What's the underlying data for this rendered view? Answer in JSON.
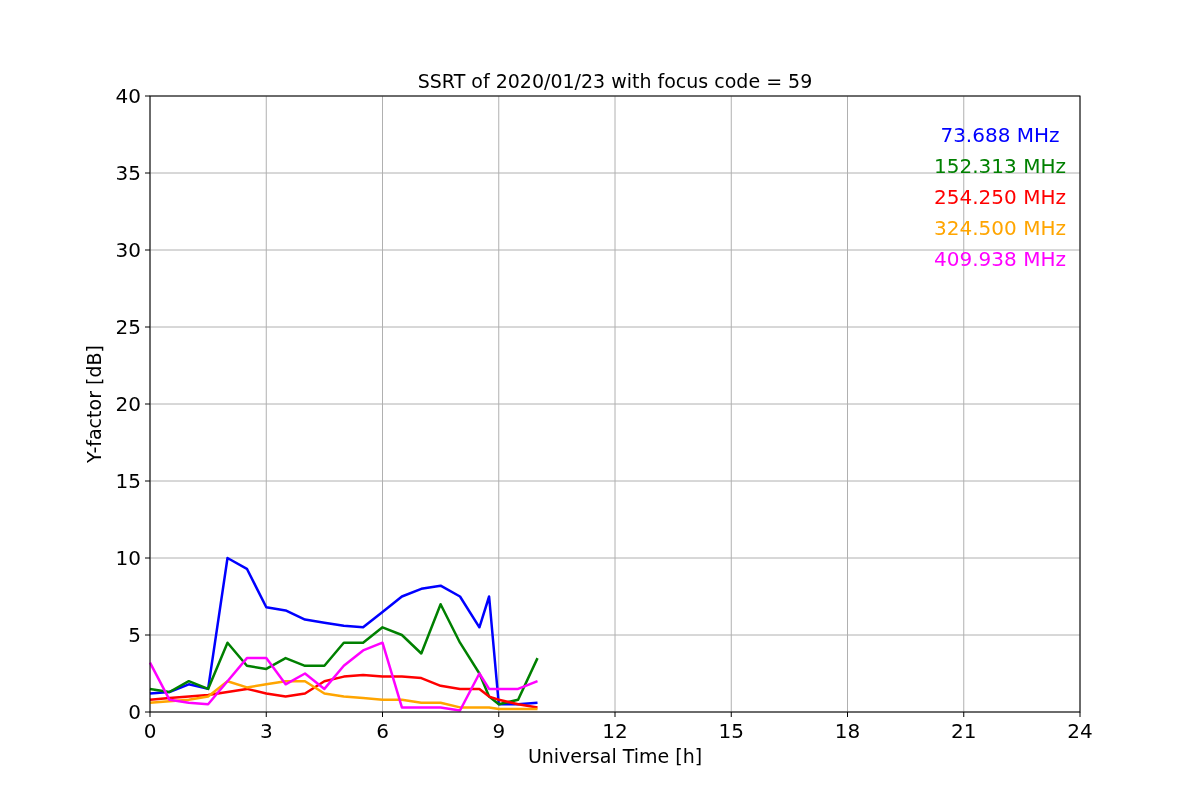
{
  "chart": {
    "chart_data": {
      "type": "line",
      "title": "SSRT of 2020/01/23 with focus code = 59",
      "xlabel": "Universal Time [h]",
      "ylabel": "Y-factor [dB]",
      "x": [
        0,
        0.5,
        1,
        1.5,
        2,
        2.5,
        3,
        3.5,
        4,
        4.5,
        5,
        5.5,
        6,
        6.5,
        7,
        7.5,
        8,
        8.5,
        8.75,
        9,
        9.5,
        10
      ],
      "series": [
        {
          "name": "73.688 MHz",
          "color": "#0000ff",
          "values": [
            1.2,
            1.3,
            1.8,
            1.5,
            10,
            9.3,
            6.8,
            6.6,
            6,
            5.8,
            5.6,
            5.5,
            6.5,
            7.5,
            8,
            8.2,
            7.5,
            5.5,
            7.5,
            0.5,
            0.5,
            0.6
          ]
        },
        {
          "name": "152.313 MHz",
          "color": "#008000",
          "values": [
            1.5,
            1.3,
            2,
            1.5,
            4.5,
            3,
            2.8,
            3.5,
            3,
            3,
            4.5,
            4.5,
            5.5,
            5,
            3.8,
            7,
            4.5,
            2.5,
            1,
            0.5,
            0.8,
            3.5
          ]
        },
        {
          "name": "254.250 MHz",
          "color": "#ff0000",
          "values": [
            0.8,
            0.9,
            1,
            1.1,
            1.3,
            1.5,
            1.2,
            1,
            1.2,
            2,
            2.3,
            2.4,
            2.3,
            2.3,
            2.2,
            1.7,
            1.5,
            1.5,
            1,
            0.8,
            0.5,
            0.3
          ]
        },
        {
          "name": "324.500 MHz",
          "color": "#ffa500",
          "values": [
            0.6,
            0.7,
            0.8,
            1,
            2,
            1.6,
            1.8,
            2,
            2,
            1.2,
            1,
            0.9,
            0.8,
            0.8,
            0.6,
            0.6,
            0.3,
            0.3,
            0.3,
            0.2,
            0.2,
            0.2
          ]
        },
        {
          "name": "409.938 MHz",
          "color": "#ff00ff",
          "values": [
            3.2,
            0.8,
            0.6,
            0.5,
            2,
            3.5,
            3.5,
            1.8,
            2.5,
            1.5,
            3,
            4,
            4.5,
            0.3,
            0.3,
            0.3,
            0.1,
            2.5,
            1.5,
            1.5,
            1.5,
            2
          ]
        }
      ],
      "xlim": [
        0,
        24
      ],
      "ylim": [
        0,
        40
      ],
      "xticks": [
        0,
        3,
        6,
        9,
        12,
        15,
        18,
        21,
        24
      ],
      "yticks": [
        0,
        5,
        10,
        15,
        20,
        25,
        30,
        35,
        40
      ],
      "grid": true
    }
  }
}
